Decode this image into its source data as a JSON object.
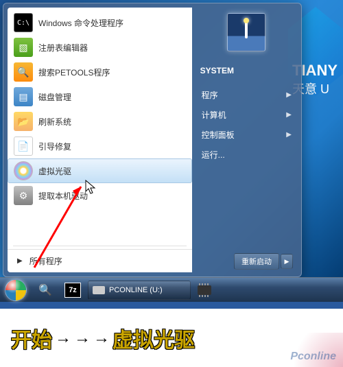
{
  "brand": {
    "en": "TIANY",
    "cn": "天意 U"
  },
  "startMenu": {
    "left": {
      "items": [
        {
          "label": "Windows 命令处理程序",
          "icon": "cmd"
        },
        {
          "label": "注册表编辑器",
          "icon": "reg"
        },
        {
          "label": "搜索PETOOLS程序",
          "icon": "search"
        },
        {
          "label": "磁盘管理",
          "icon": "disk"
        },
        {
          "label": "刷新系统",
          "icon": "refresh"
        },
        {
          "label": "引导修复",
          "icon": "boot"
        },
        {
          "label": "虚拟光驱",
          "icon": "cd"
        },
        {
          "label": "提取本机驱动",
          "icon": "drv"
        }
      ],
      "allPrograms": "所有程序"
    },
    "right": {
      "userName": "SYSTEM",
      "items": [
        {
          "label": "程序",
          "hasSub": true
        },
        {
          "label": "计算机",
          "hasSub": true
        },
        {
          "label": "控制面板",
          "hasSub": true
        },
        {
          "label": "运行...",
          "hasSub": false
        }
      ],
      "power": "重新启动"
    }
  },
  "taskbar": {
    "driveButton": "PCONLINE (U:)"
  },
  "caption": {
    "part1": "开始",
    "part2": "虚拟光驱"
  },
  "watermark": "Pconline"
}
